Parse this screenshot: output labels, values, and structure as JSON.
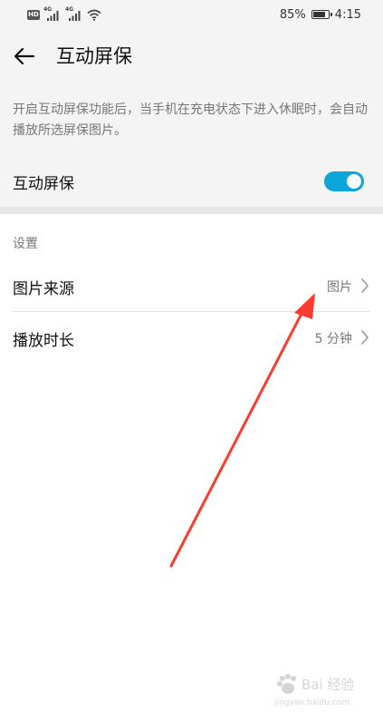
{
  "status_bar": {
    "battery_text": "85%",
    "battery_level": 0.85,
    "time": "4:15",
    "left_icons": [
      "hd-icon",
      "4g-signal-icon",
      "4g-signal-icon",
      "wifi-icon"
    ],
    "network_label_1": "4G",
    "network_label_2": "4G",
    "hd_label": "HD"
  },
  "header": {
    "title": "互动屏保",
    "back_icon": "back-arrow-icon"
  },
  "intro": {
    "description": "开启互动屏保功能后，当手机在充电状态下进入休眠时，会自动播放所选屏保图片。",
    "toggle_label": "互动屏保",
    "toggle_on": true,
    "accent_color": "#0ea5d8"
  },
  "settings": {
    "section_title": "设置",
    "rows": [
      {
        "label": "图片来源",
        "value": "图片",
        "icon": "chevron-right-icon"
      },
      {
        "label": "播放时长",
        "value": "5 分钟",
        "icon": "chevron-right-icon"
      }
    ]
  },
  "annotation": {
    "color": "#ff3b30"
  },
  "watermark": {
    "text": "Bai 经验",
    "sub": "jingyan.baidu.com"
  }
}
